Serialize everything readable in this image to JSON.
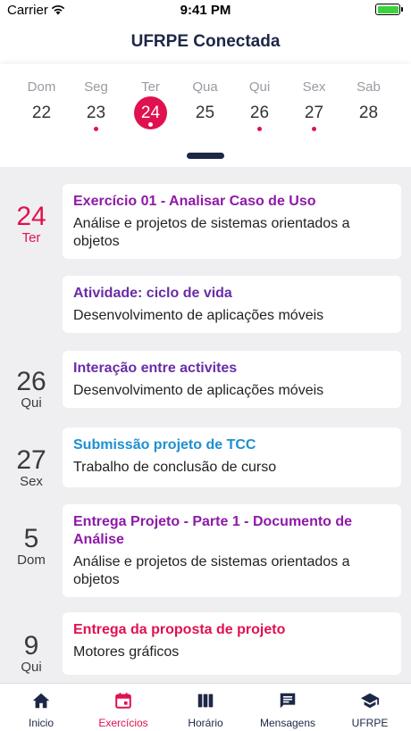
{
  "status": {
    "carrier": "Carrier",
    "time": "9:41 PM"
  },
  "header": {
    "title": "UFRPE Conectada"
  },
  "week": [
    {
      "name": "Dom",
      "num": "22",
      "dot": false,
      "selected": false
    },
    {
      "name": "Seg",
      "num": "23",
      "dot": true,
      "selected": false
    },
    {
      "name": "Ter",
      "num": "24",
      "dot": true,
      "selected": true
    },
    {
      "name": "Qua",
      "num": "25",
      "dot": false,
      "selected": false
    },
    {
      "name": "Qui",
      "num": "26",
      "dot": true,
      "selected": false
    },
    {
      "name": "Sex",
      "num": "27",
      "dot": true,
      "selected": false
    },
    {
      "name": "Sab",
      "num": "28",
      "dot": false,
      "selected": false
    }
  ],
  "dates": [
    {
      "num": "24",
      "weekday": "Ter"
    },
    {
      "num": "26",
      "weekday": "Qui"
    },
    {
      "num": "27",
      "weekday": "Sex"
    },
    {
      "num": "5",
      "weekday": "Dom"
    },
    {
      "num": "9",
      "weekday": "Qui"
    }
  ],
  "tasks": [
    {
      "title": "Exercício 01 - Analisar Caso de Uso",
      "subject": "Análise e projetos de sistemas orientados a objetos",
      "color": "#8e1aa8"
    },
    {
      "title": "Atividade: ciclo de vida",
      "subject": "Desenvolvimento de aplicações móveis",
      "color": "#6a2ca8"
    },
    {
      "title": "Interação entre activites",
      "subject": "Desenvolvimento de aplicações móveis",
      "color": "#6a2ca8"
    },
    {
      "title": "Submissão projeto de TCC",
      "subject": "Trabalho de conclusão de curso",
      "color": "#1e8fd0"
    },
    {
      "title": "Entrega Projeto - Parte 1 - Documento de Análise",
      "subject": "Análise e projetos de sistemas orientados a objetos",
      "color": "#8e1aa8"
    },
    {
      "title": "Entrega da proposta de projeto",
      "subject": "Motores gráficos",
      "color": "#e0114f"
    }
  ],
  "tabs": [
    {
      "label": "Inicio",
      "icon": "home-icon"
    },
    {
      "label": "Exercícios",
      "icon": "calendar-icon"
    },
    {
      "label": "Horário",
      "icon": "columns-icon"
    },
    {
      "label": "Mensagens",
      "icon": "chat-icon"
    },
    {
      "label": "UFRPE",
      "icon": "graduation-cap-icon"
    }
  ],
  "colors": {
    "accent": "#e0114f",
    "navy": "#1d2746",
    "battery": "#3ad33a"
  }
}
